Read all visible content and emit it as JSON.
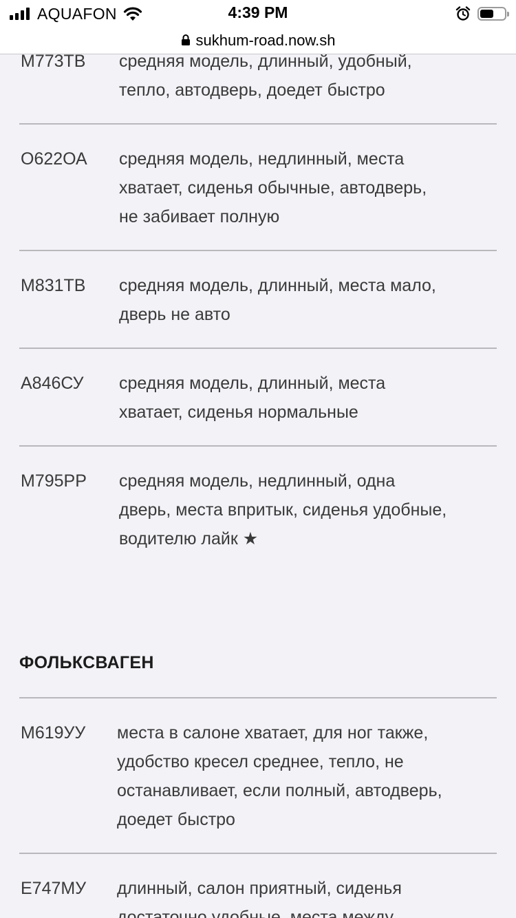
{
  "status_bar": {
    "carrier": "AQUAFON",
    "time": "4:39 PM",
    "battery_level": 0.55,
    "icons": [
      "signal-icon",
      "wifi-icon",
      "alarm-icon",
      "battery-icon"
    ]
  },
  "browser": {
    "url": "sukhum-road.now.sh",
    "lock_icon": "lock-icon"
  },
  "entries_group_1": [
    {
      "plate": "М773ТВ",
      "description": "средняя модель, длинный, удобный,\nтепло, автодверь, доедет быстро"
    },
    {
      "plate": "О622ОА",
      "description": "средняя модель, недлинный, места\nхватает, сиденья обычные, автодверь,\nне забивает полную"
    },
    {
      "plate": "М831ТВ",
      "description": "средняя модель, длинный, места мало,\nдверь не авто"
    },
    {
      "plate": "А846СУ",
      "description": "средняя модель, длинный, места\nхватает, сиденья нормальные"
    },
    {
      "plate": "М795РР",
      "description": "средняя модель, недлинный, одна\nдверь, места впритык, сиденья удобные,\nводителю лайк ★"
    }
  ],
  "section_heading": "ФОЛЬКСВАГЕН",
  "entries_group_2": [
    {
      "plate": "М619УУ",
      "description": "места в салоне хватает, для ног также,\nудобство кресел среднее, тепло, не\nостанавливает, если полный, автодверь,\nдоедет быстро"
    },
    {
      "plate": "Е747МУ",
      "description": "длинный, салон приятный, сиденья\nдостаточно удобные, места между"
    }
  ],
  "colors": {
    "background": "#f2f2f7",
    "text": "#3a3a3a",
    "divider": "#b8b8bc"
  }
}
